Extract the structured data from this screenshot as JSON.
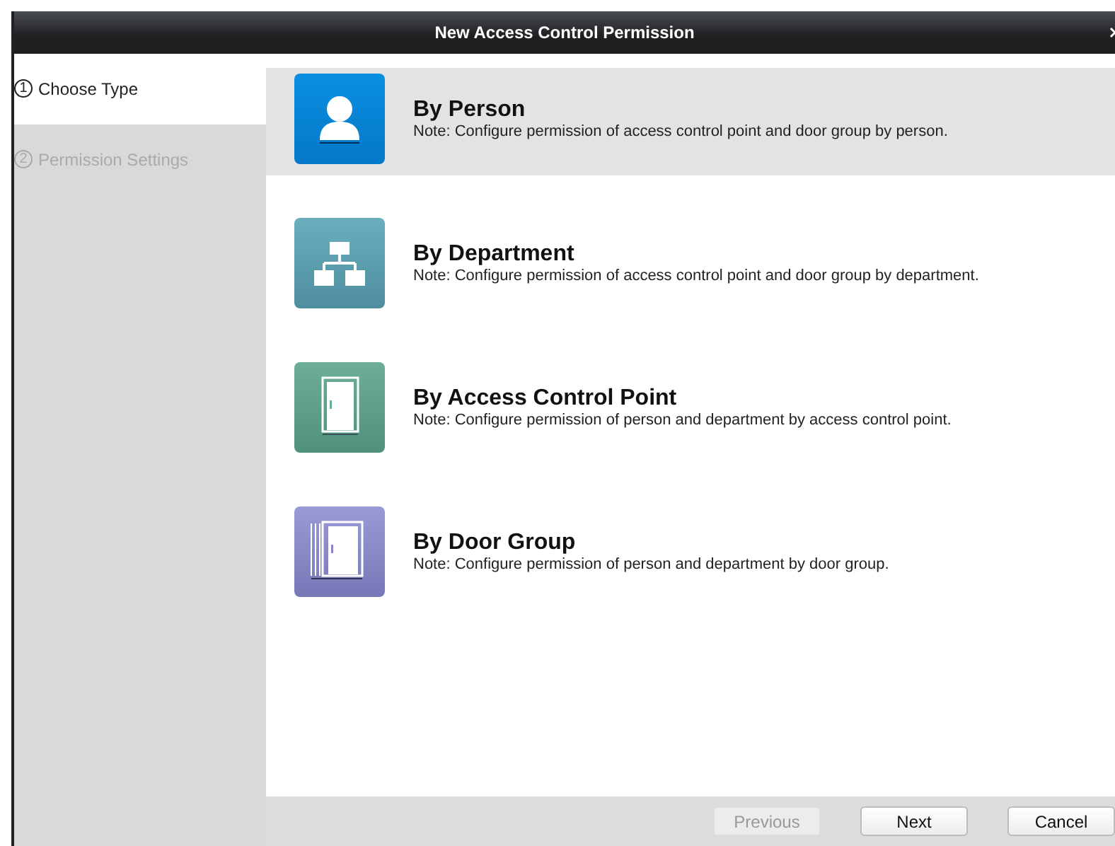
{
  "window": {
    "title": "New Access Control Permission"
  },
  "steps": [
    {
      "number": "1",
      "label": "Choose Type",
      "selected": true
    },
    {
      "number": "2",
      "label": "Permission Settings",
      "selected": false
    }
  ],
  "options": [
    {
      "kind": "person",
      "title": "By Person",
      "note": "Note: Configure permission of access control point and door group by person.",
      "selected": true
    },
    {
      "kind": "department",
      "title": "By Department",
      "note": "Note: Configure permission of access control point and door group by department.",
      "selected": false
    },
    {
      "kind": "point",
      "title": "By Access Control Point",
      "note": "Note: Configure permission of person and department by access control point.",
      "selected": false
    },
    {
      "kind": "group",
      "title": "By Door Group",
      "note": "Note: Configure permission of person and department by door group.",
      "selected": false
    }
  ],
  "buttons": [
    {
      "label": "Previous",
      "disabled": true
    },
    {
      "label": "Next",
      "disabled": false
    },
    {
      "label": "Cancel",
      "disabled": false
    }
  ]
}
